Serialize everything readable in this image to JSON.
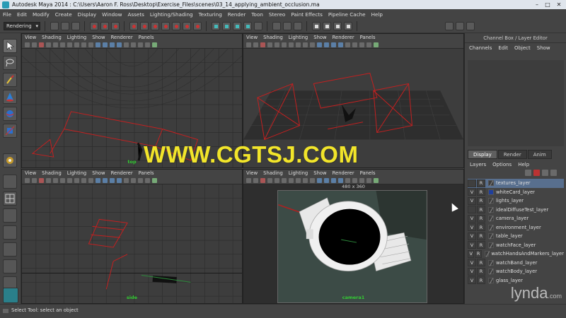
{
  "window": {
    "title": "Autodesk Maya 2014 :  C:\\Users\\Aaron F. Ross\\Desktop\\Exercise_Files\\scenes\\03_14_applying_ambient_occlusion.ma",
    "minimize": "–",
    "maximize": "□",
    "close": "✕"
  },
  "menubar": {
    "items": [
      "File",
      "Edit",
      "Modify",
      "Create",
      "Display",
      "Window",
      "Assets",
      "Lighting/Shading",
      "Texturing",
      "Render",
      "Toon",
      "Stereo",
      "Paint Effects",
      "Pipeline Cache",
      "Help"
    ]
  },
  "statusline": {
    "mode": "Rendering",
    "mode_arrow": "▾"
  },
  "viewport_menu": [
    "View",
    "Shading",
    "Lighting",
    "Show",
    "Renderer",
    "Panels"
  ],
  "viewports": {
    "top": {
      "label": "top"
    },
    "persp": {
      "label": ""
    },
    "side": {
      "label": "side"
    },
    "camera": {
      "label": "camera1",
      "resolution": "480 x 360"
    }
  },
  "channelbox": {
    "title": "Channel Box / Layer Editor",
    "menu": [
      "Channels",
      "Edit",
      "Object",
      "Show"
    ]
  },
  "layer_editor": {
    "tabs": [
      "Display",
      "Render",
      "Anim"
    ],
    "menu": [
      "Layers",
      "Options",
      "Help"
    ],
    "layers": [
      {
        "v": "",
        "r": "R",
        "swatch": "slash",
        "name": "textures_layer",
        "selected": true
      },
      {
        "v": "V",
        "r": "R",
        "swatch": "blue",
        "name": "whiteCard_layer",
        "selected": false
      },
      {
        "v": "V",
        "r": "R",
        "swatch": "slash",
        "name": "lights_layer",
        "selected": false
      },
      {
        "v": "",
        "r": "R",
        "swatch": "slash",
        "name": "idealDiffuseTest_layer",
        "selected": false
      },
      {
        "v": "V",
        "r": "R",
        "swatch": "slash",
        "name": "camera_layer",
        "selected": false
      },
      {
        "v": "V",
        "r": "R",
        "swatch": "slash",
        "name": "environment_layer",
        "selected": false
      },
      {
        "v": "V",
        "r": "R",
        "swatch": "slash",
        "name": "table_layer",
        "selected": false
      },
      {
        "v": "V",
        "r": "R",
        "swatch": "slash",
        "name": "watchFace_layer",
        "selected": false
      },
      {
        "v": "V",
        "r": "R",
        "swatch": "slash",
        "name": "watchHandsAndMarkers_layer",
        "selected": false
      },
      {
        "v": "V",
        "r": "R",
        "swatch": "slash",
        "name": "watchBand_layer",
        "selected": false
      },
      {
        "v": "V",
        "r": "R",
        "swatch": "slash",
        "name": "watchBody_layer",
        "selected": false
      },
      {
        "v": "V",
        "r": "R",
        "swatch": "slash",
        "name": "glass_layer",
        "selected": false
      }
    ]
  },
  "helpline": {
    "text": "Select Tool: select an object"
  },
  "overlay": {
    "watermark": "WWW.CGTSJ.COM",
    "brand": "lynda",
    "brand_suffix": ".com"
  },
  "colors": {
    "accent_red": "#d01f1f",
    "label_green": "#33cc33",
    "watermark_yellow": "#f2e52a",
    "selected_layer": "#586f8e"
  }
}
